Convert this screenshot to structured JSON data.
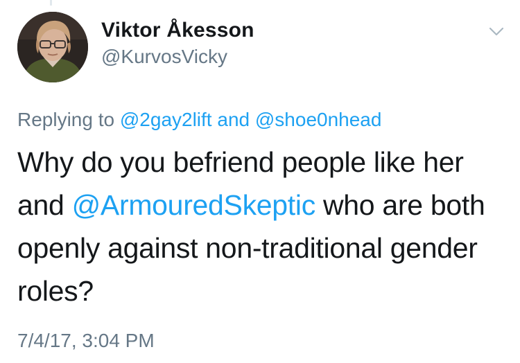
{
  "tweet": {
    "author": {
      "display_name": "Viktor Åkesson",
      "handle": "@KurvosVicky"
    },
    "replying_to": {
      "prefix": "Replying to",
      "mention_1": "@2gay2lift",
      "conjunction": "and",
      "mention_2": "@shoe0nhead"
    },
    "text": {
      "part_1": "Why do you befriend people like her and ",
      "mention": "@ArmouredSkeptic",
      "part_2": " who are both openly against non-traditional gender roles?"
    },
    "timestamp": "7/4/17, 3:04 PM"
  },
  "icons": {
    "menu": "chevron-down-icon",
    "avatar": "profile-photo"
  },
  "colors": {
    "link": "#1da1f2",
    "secondary_text": "#657786",
    "primary_text": "#14171a",
    "background": "#ffffff",
    "thread_line": "#e1e8ed"
  }
}
